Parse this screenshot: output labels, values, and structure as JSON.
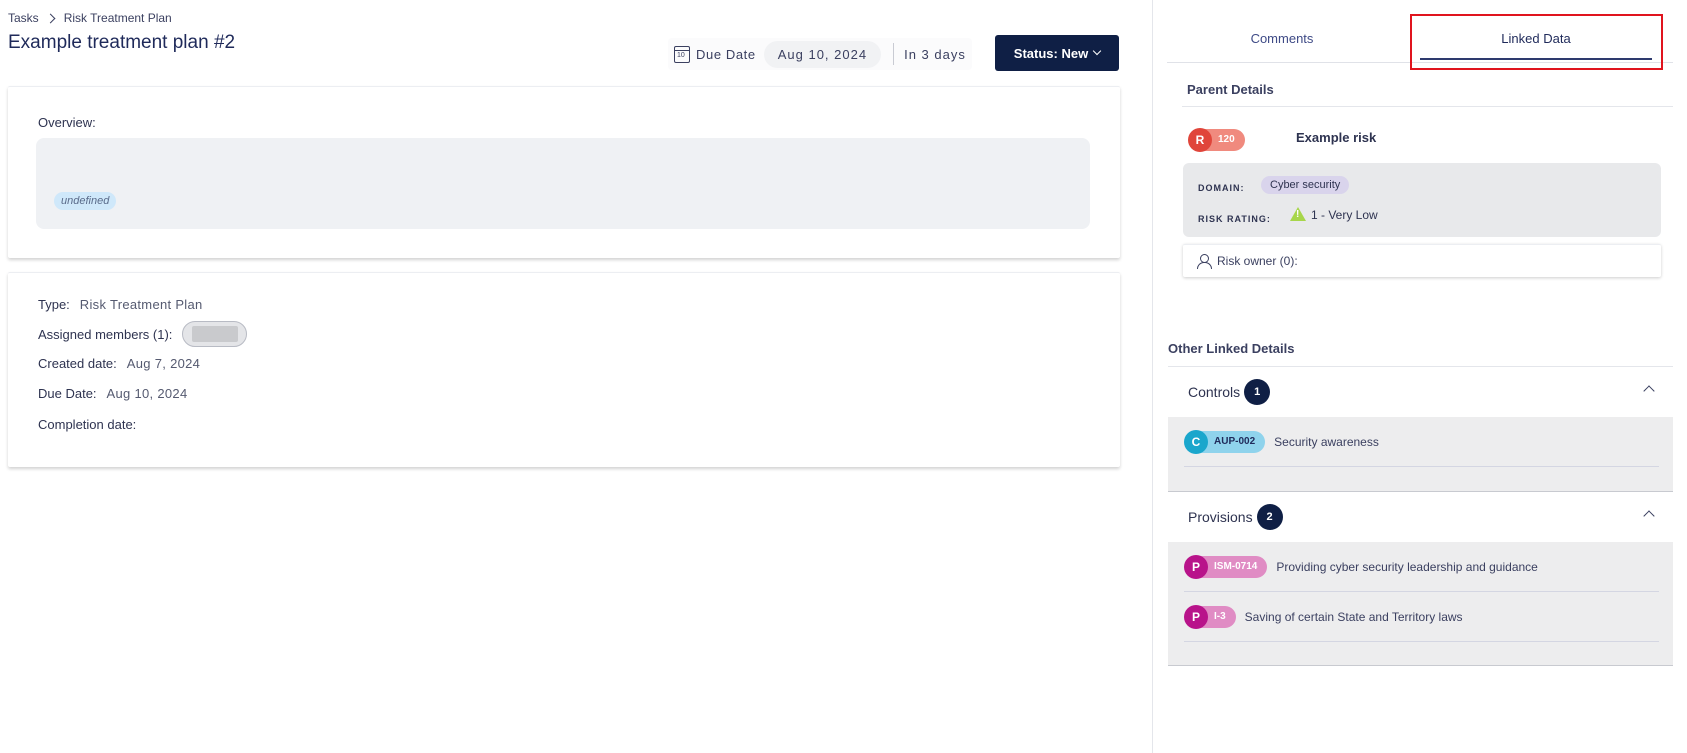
{
  "breadcrumb": {
    "root": "Tasks",
    "current": "Risk Treatment Plan"
  },
  "page": {
    "title": "Example treatment plan #2"
  },
  "due": {
    "label": "Due Date",
    "date": "Aug 10, 2024",
    "relative": "In 3 days"
  },
  "status": {
    "label": "Status: New"
  },
  "overview": {
    "label": "Overview:",
    "chip": "undefined"
  },
  "details": {
    "type_label": "Type:",
    "type_value": "Risk Treatment Plan",
    "members_label": "Assigned members (1):",
    "created_label": "Created date:",
    "created_value": "Aug 7, 2024",
    "due_label": "Due Date:",
    "due_value": "Aug 10, 2024",
    "completion_label": "Completion date:"
  },
  "tabs": {
    "comments": "Comments",
    "linked": "Linked Data",
    "active": "Linked Data"
  },
  "parent": {
    "title": "Parent Details",
    "badge_letter": "R",
    "badge_number": "120",
    "name": "Example risk",
    "domain_label": "DOMAIN:",
    "domain_value": "Cyber security",
    "rating_label": "RISK RATING:",
    "rating_value": "1 - Very Low",
    "owner": "Risk owner (0):"
  },
  "other": {
    "title": "Other Linked Details",
    "controls": {
      "label": "Controls",
      "count": "1",
      "items": [
        {
          "letter": "C",
          "code": "AUP-002",
          "name": "Security awareness"
        }
      ]
    },
    "provisions": {
      "label": "Provisions",
      "count": "2",
      "items": [
        {
          "letter": "P",
          "code": "ISM-0714",
          "name": "Providing cyber security leadership and guidance"
        },
        {
          "letter": "P",
          "code": "I-3",
          "name": "Saving of certain State and Territory laws"
        }
      ]
    }
  },
  "colors": {
    "primary": "#0f1f45",
    "highlight": "#e0141e",
    "risk": "#e0453a",
    "control": "#1aa6cc",
    "provision": "#b8138a"
  }
}
